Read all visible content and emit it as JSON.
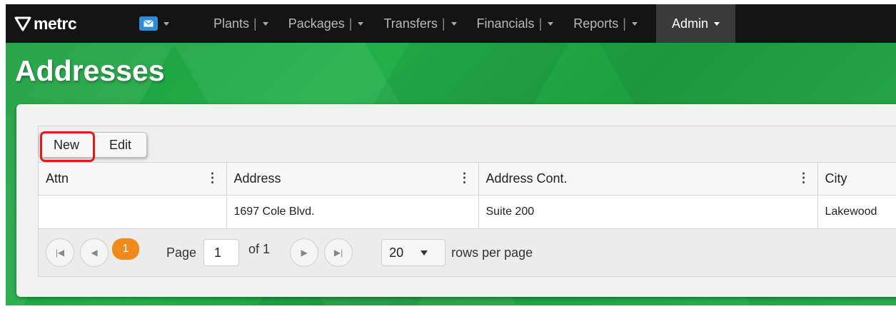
{
  "navbar": {
    "brand": "metrc",
    "items": [
      {
        "label": "Plants"
      },
      {
        "label": "Packages"
      },
      {
        "label": "Transfers"
      },
      {
        "label": "Financials"
      },
      {
        "label": "Reports"
      }
    ],
    "sep": "|",
    "active": {
      "label": "Admin"
    }
  },
  "page": {
    "title": "Addresses"
  },
  "toolbar": {
    "new_label": "New",
    "edit_label": "Edit"
  },
  "table": {
    "columns": [
      "Attn",
      "Address",
      "Address Cont.",
      "City"
    ],
    "rows": [
      {
        "attn": "",
        "address": "1697 Cole Blvd.",
        "address_cont": "Suite 200",
        "city": "Lakewood"
      }
    ]
  },
  "pager": {
    "current": "1",
    "page_label": "Page",
    "page_value": "1",
    "of_label": "of 1",
    "rows_value": "20",
    "rows_label": "rows per page"
  },
  "colors": {
    "highlight": "#e01b1b",
    "accent": "#f08a1b",
    "nav_bg": "#141414"
  }
}
